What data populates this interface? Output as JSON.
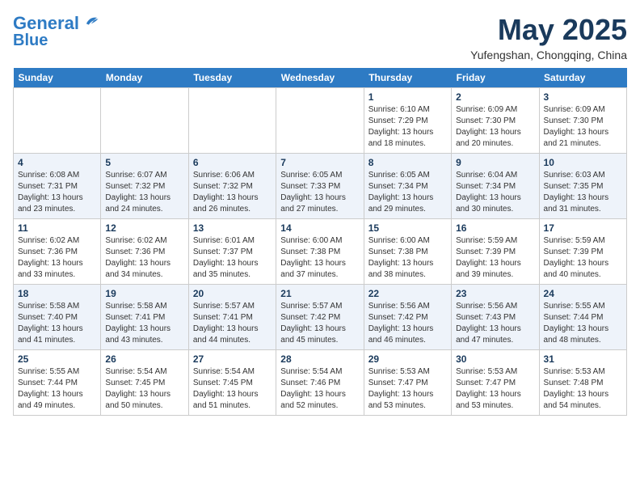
{
  "header": {
    "logo_line1": "General",
    "logo_line2": "Blue",
    "month_year": "May 2025",
    "location": "Yufengshan, Chongqing, China"
  },
  "days_of_week": [
    "Sunday",
    "Monday",
    "Tuesday",
    "Wednesday",
    "Thursday",
    "Friday",
    "Saturday"
  ],
  "weeks": [
    [
      {
        "num": "",
        "info": ""
      },
      {
        "num": "",
        "info": ""
      },
      {
        "num": "",
        "info": ""
      },
      {
        "num": "",
        "info": ""
      },
      {
        "num": "1",
        "info": "Sunrise: 6:10 AM\nSunset: 7:29 PM\nDaylight: 13 hours\nand 18 minutes."
      },
      {
        "num": "2",
        "info": "Sunrise: 6:09 AM\nSunset: 7:30 PM\nDaylight: 13 hours\nand 20 minutes."
      },
      {
        "num": "3",
        "info": "Sunrise: 6:09 AM\nSunset: 7:30 PM\nDaylight: 13 hours\nand 21 minutes."
      }
    ],
    [
      {
        "num": "4",
        "info": "Sunrise: 6:08 AM\nSunset: 7:31 PM\nDaylight: 13 hours\nand 23 minutes."
      },
      {
        "num": "5",
        "info": "Sunrise: 6:07 AM\nSunset: 7:32 PM\nDaylight: 13 hours\nand 24 minutes."
      },
      {
        "num": "6",
        "info": "Sunrise: 6:06 AM\nSunset: 7:32 PM\nDaylight: 13 hours\nand 26 minutes."
      },
      {
        "num": "7",
        "info": "Sunrise: 6:05 AM\nSunset: 7:33 PM\nDaylight: 13 hours\nand 27 minutes."
      },
      {
        "num": "8",
        "info": "Sunrise: 6:05 AM\nSunset: 7:34 PM\nDaylight: 13 hours\nand 29 minutes."
      },
      {
        "num": "9",
        "info": "Sunrise: 6:04 AM\nSunset: 7:34 PM\nDaylight: 13 hours\nand 30 minutes."
      },
      {
        "num": "10",
        "info": "Sunrise: 6:03 AM\nSunset: 7:35 PM\nDaylight: 13 hours\nand 31 minutes."
      }
    ],
    [
      {
        "num": "11",
        "info": "Sunrise: 6:02 AM\nSunset: 7:36 PM\nDaylight: 13 hours\nand 33 minutes."
      },
      {
        "num": "12",
        "info": "Sunrise: 6:02 AM\nSunset: 7:36 PM\nDaylight: 13 hours\nand 34 minutes."
      },
      {
        "num": "13",
        "info": "Sunrise: 6:01 AM\nSunset: 7:37 PM\nDaylight: 13 hours\nand 35 minutes."
      },
      {
        "num": "14",
        "info": "Sunrise: 6:00 AM\nSunset: 7:38 PM\nDaylight: 13 hours\nand 37 minutes."
      },
      {
        "num": "15",
        "info": "Sunrise: 6:00 AM\nSunset: 7:38 PM\nDaylight: 13 hours\nand 38 minutes."
      },
      {
        "num": "16",
        "info": "Sunrise: 5:59 AM\nSunset: 7:39 PM\nDaylight: 13 hours\nand 39 minutes."
      },
      {
        "num": "17",
        "info": "Sunrise: 5:59 AM\nSunset: 7:39 PM\nDaylight: 13 hours\nand 40 minutes."
      }
    ],
    [
      {
        "num": "18",
        "info": "Sunrise: 5:58 AM\nSunset: 7:40 PM\nDaylight: 13 hours\nand 41 minutes."
      },
      {
        "num": "19",
        "info": "Sunrise: 5:58 AM\nSunset: 7:41 PM\nDaylight: 13 hours\nand 43 minutes."
      },
      {
        "num": "20",
        "info": "Sunrise: 5:57 AM\nSunset: 7:41 PM\nDaylight: 13 hours\nand 44 minutes."
      },
      {
        "num": "21",
        "info": "Sunrise: 5:57 AM\nSunset: 7:42 PM\nDaylight: 13 hours\nand 45 minutes."
      },
      {
        "num": "22",
        "info": "Sunrise: 5:56 AM\nSunset: 7:42 PM\nDaylight: 13 hours\nand 46 minutes."
      },
      {
        "num": "23",
        "info": "Sunrise: 5:56 AM\nSunset: 7:43 PM\nDaylight: 13 hours\nand 47 minutes."
      },
      {
        "num": "24",
        "info": "Sunrise: 5:55 AM\nSunset: 7:44 PM\nDaylight: 13 hours\nand 48 minutes."
      }
    ],
    [
      {
        "num": "25",
        "info": "Sunrise: 5:55 AM\nSunset: 7:44 PM\nDaylight: 13 hours\nand 49 minutes."
      },
      {
        "num": "26",
        "info": "Sunrise: 5:54 AM\nSunset: 7:45 PM\nDaylight: 13 hours\nand 50 minutes."
      },
      {
        "num": "27",
        "info": "Sunrise: 5:54 AM\nSunset: 7:45 PM\nDaylight: 13 hours\nand 51 minutes."
      },
      {
        "num": "28",
        "info": "Sunrise: 5:54 AM\nSunset: 7:46 PM\nDaylight: 13 hours\nand 52 minutes."
      },
      {
        "num": "29",
        "info": "Sunrise: 5:53 AM\nSunset: 7:47 PM\nDaylight: 13 hours\nand 53 minutes."
      },
      {
        "num": "30",
        "info": "Sunrise: 5:53 AM\nSunset: 7:47 PM\nDaylight: 13 hours\nand 53 minutes."
      },
      {
        "num": "31",
        "info": "Sunrise: 5:53 AM\nSunset: 7:48 PM\nDaylight: 13 hours\nand 54 minutes."
      }
    ]
  ]
}
